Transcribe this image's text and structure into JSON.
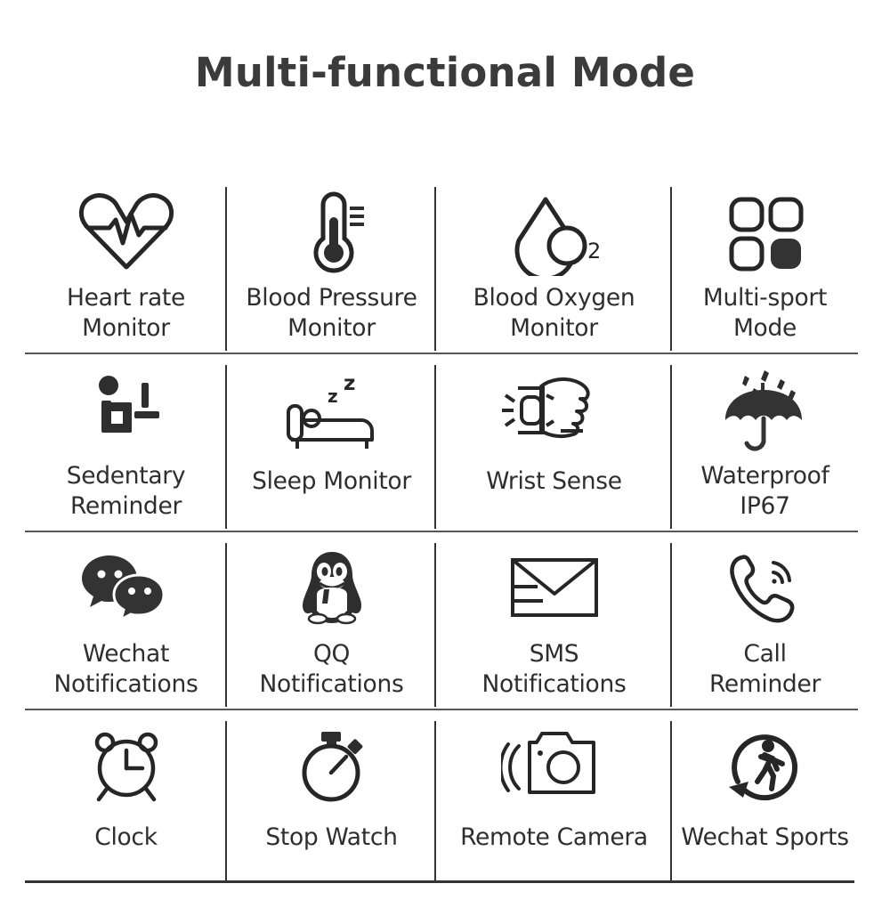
{
  "header": {
    "title": "Multi-functional Mode"
  },
  "colors": {
    "text": "#2e2e2e",
    "title": "#3b3b3b",
    "icon": "#333333",
    "divider_vertical": "#333333",
    "divider_horizontal": "#555555",
    "background": "#ffffff"
  },
  "grid": {
    "columns": 4,
    "rows": 4,
    "features": [
      {
        "icon": "heart-rate-icon",
        "label": "Heart rate\nMonitor",
        "lines": 2
      },
      {
        "icon": "thermometer-icon",
        "label": "Blood Pressure\nMonitor",
        "lines": 2
      },
      {
        "icon": "blood-oxygen-droplet-icon",
        "label": "Blood Oxygen\nMonitor",
        "lines": 2,
        "badge": "O",
        "badge_sub": "2"
      },
      {
        "icon": "multi-sport-grid-icon",
        "label": "Multi-sport\nMode",
        "lines": 2
      },
      {
        "icon": "sedentary-person-icon",
        "label": "Sedentary\nReminder",
        "lines": 2
      },
      {
        "icon": "sleep-bed-icon",
        "label": "Sleep Monitor",
        "lines": 1,
        "zzz": "z z"
      },
      {
        "icon": "wrist-sense-hand-icon",
        "label": "Wrist Sense",
        "lines": 1
      },
      {
        "icon": "umbrella-rain-icon",
        "label": "Waterproof\nIP67",
        "lines": 2
      },
      {
        "icon": "wechat-icon",
        "label": "Wechat\nNotifications",
        "lines": 2
      },
      {
        "icon": "qq-penguin-icon",
        "label": "QQ\nNotifications",
        "lines": 2
      },
      {
        "icon": "envelope-icon",
        "label": "SMS\nNotifications",
        "lines": 2
      },
      {
        "icon": "phone-call-icon",
        "label": "Call\nReminder",
        "lines": 2
      },
      {
        "icon": "alarm-clock-icon",
        "label": "Clock",
        "lines": 1
      },
      {
        "icon": "stopwatch-icon",
        "label": "Stop Watch",
        "lines": 1
      },
      {
        "icon": "remote-camera-icon",
        "label": "Remote Camera",
        "lines": 1
      },
      {
        "icon": "wechat-sports-runner-icon",
        "label": "Wechat Sports",
        "lines": 1
      }
    ]
  }
}
